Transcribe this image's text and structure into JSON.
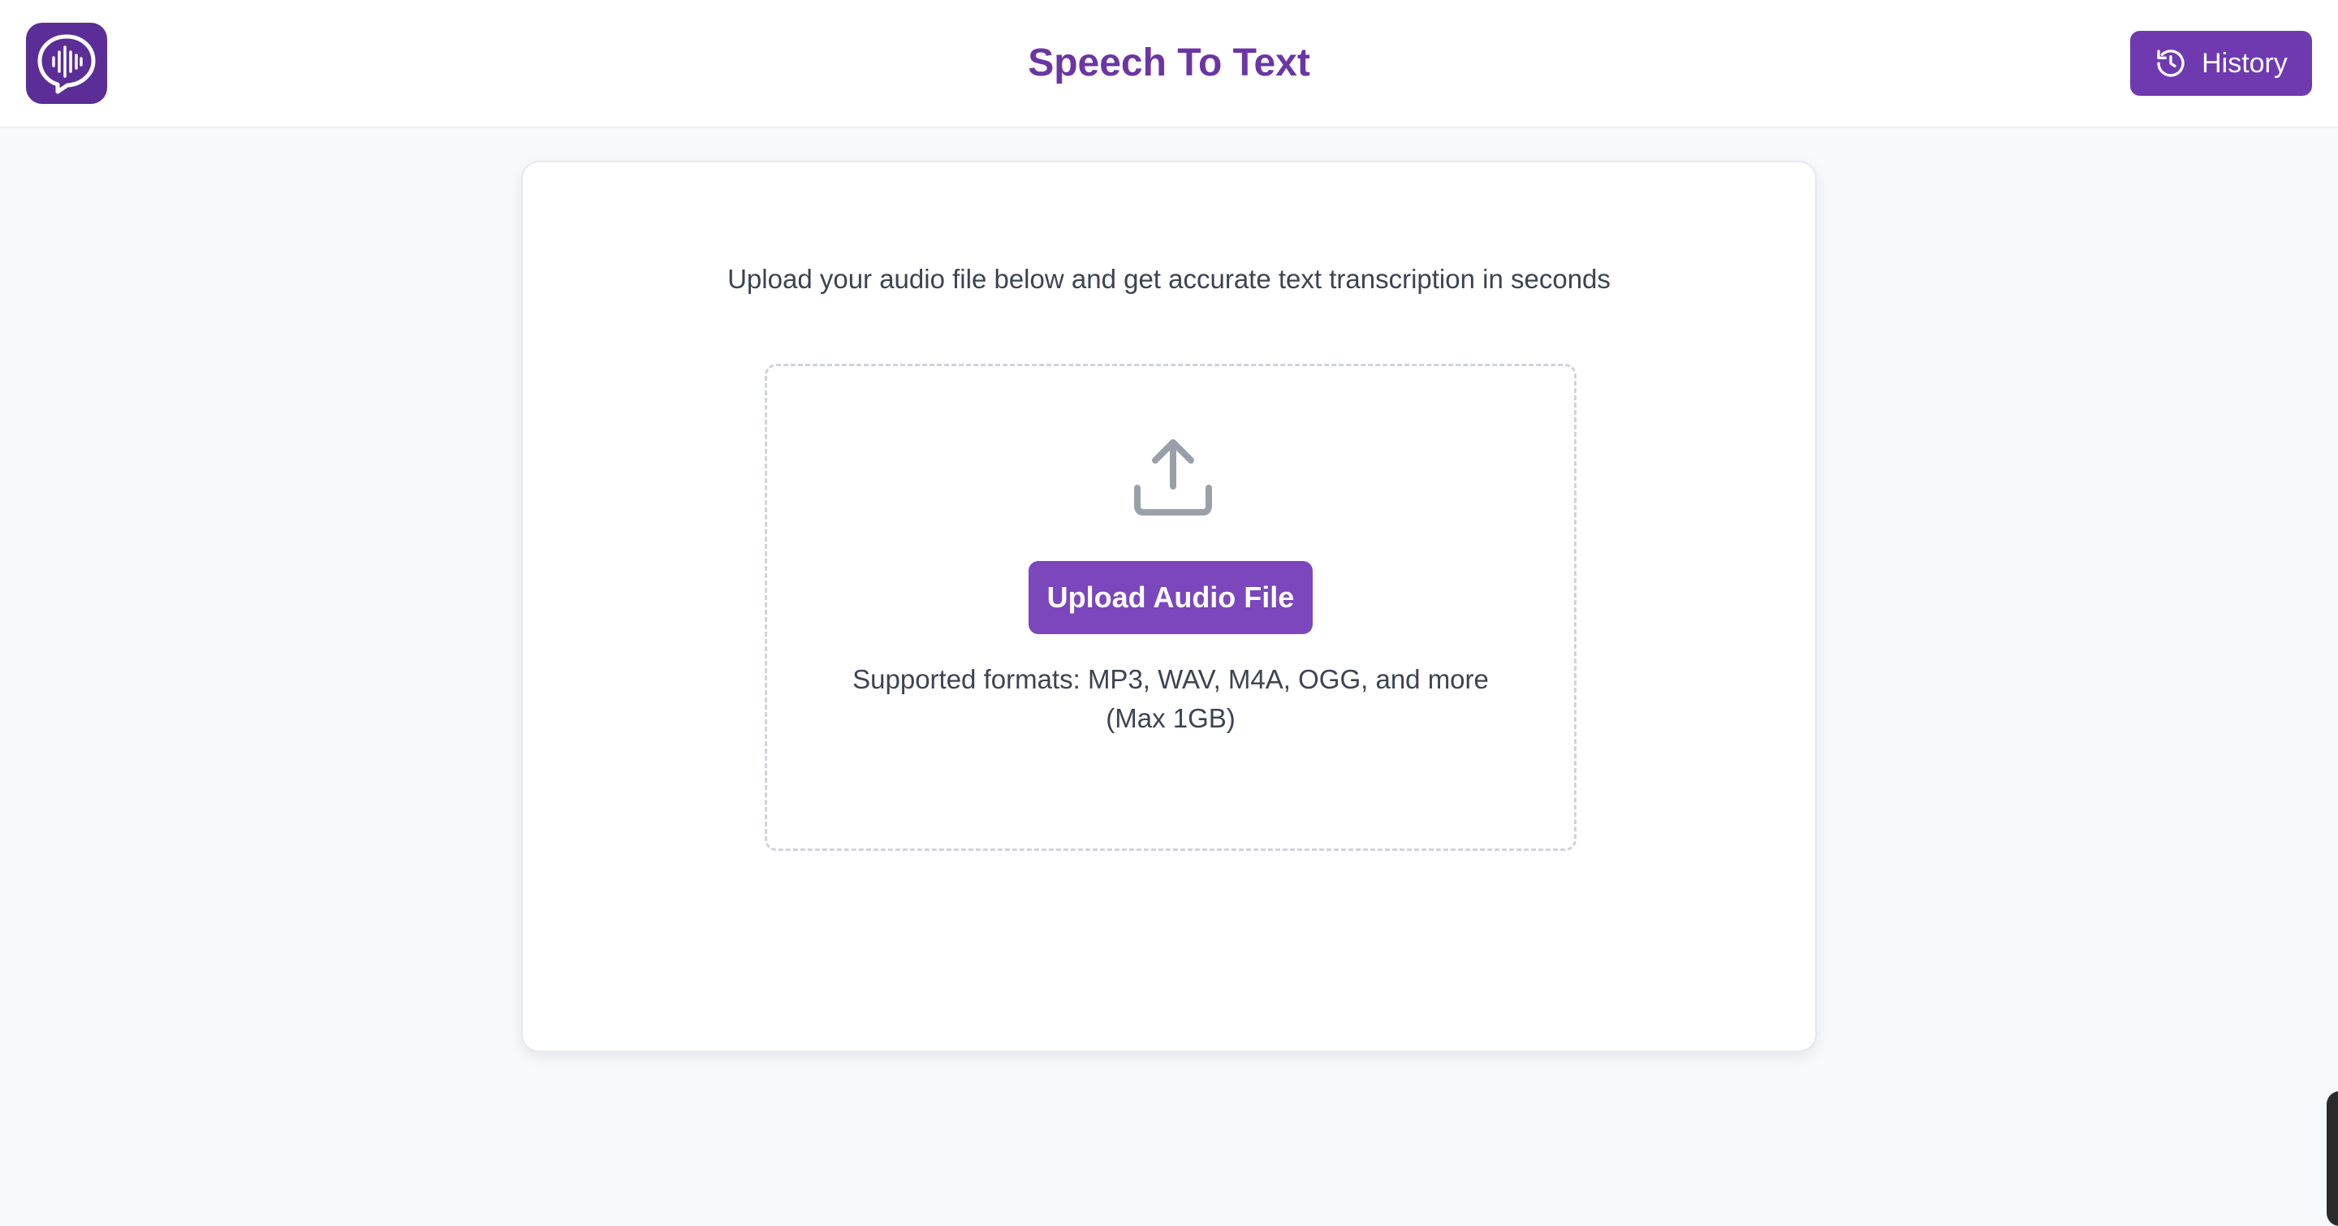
{
  "header": {
    "title": "Speech To Text",
    "logo_icon": "speech-bubble-waveform-icon",
    "history_label": "History",
    "history_icon": "history-clock-icon"
  },
  "main": {
    "intro_text": "Upload your audio file below and get accurate text transcription in seconds",
    "upload_icon": "upload-icon",
    "upload_button_label": "Upload Audio File",
    "formats_line1": "Supported formats: MP3, WAV, M4A, OGG, and more",
    "formats_line2": "(Max 1GB)"
  },
  "colors": {
    "brand": "#6b35a6",
    "button": "#7c46bd",
    "logo_bg": "#5b2d96",
    "background": "#f8f9fb"
  }
}
